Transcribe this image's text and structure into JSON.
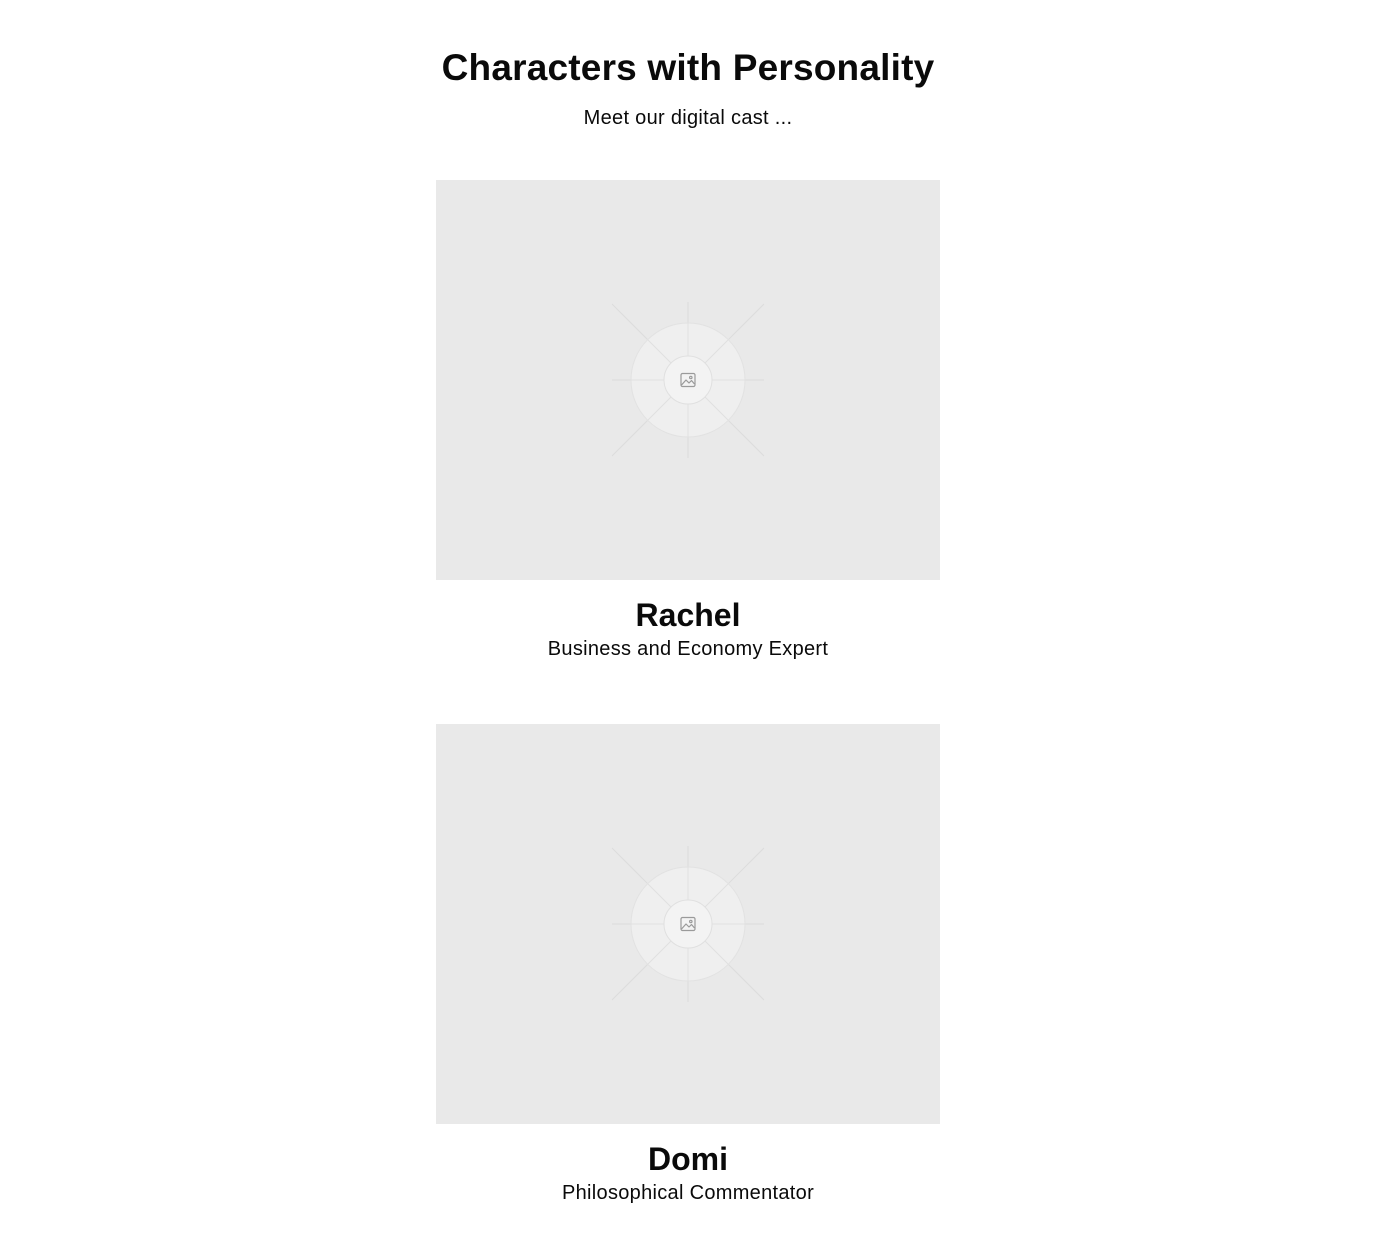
{
  "header": {
    "title": "Characters with Personality",
    "subtitle": "Meet our digital cast ..."
  },
  "characters": [
    {
      "name": "Rachel",
      "role": "Business and Economy Expert",
      "image_icon": "image-placeholder-icon"
    },
    {
      "name": "Domi",
      "role": "Philosophical Commentator",
      "image_icon": "image-placeholder-icon"
    }
  ],
  "colors": {
    "background": "#ffffff",
    "placeholder": "#e9e9e9",
    "text": "#0a0a0a"
  }
}
